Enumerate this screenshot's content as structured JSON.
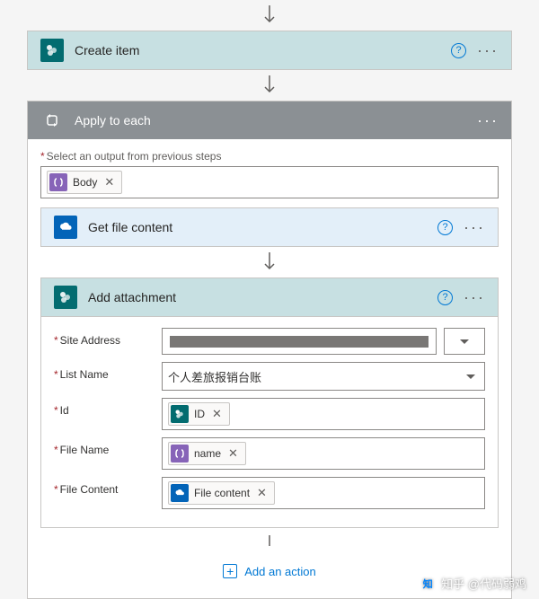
{
  "create_item": {
    "title": "Create item"
  },
  "apply": {
    "title": "Apply to each",
    "output_label": "Select an output from previous steps",
    "body_token": "Body"
  },
  "get_file": {
    "title": "Get file content"
  },
  "add_attachment": {
    "title": "Add attachment",
    "site_label": "Site Address",
    "list_label": "List Name",
    "list_value": "个人差旅报销台账",
    "id_label": "Id",
    "id_token": "ID",
    "filename_label": "File Name",
    "filename_token": "name",
    "filecontent_label": "File Content",
    "filecontent_token": "File content"
  },
  "add_action_label": "Add an action",
  "watermark": {
    "logo": "知",
    "text": "知乎 @代码弱鸡"
  }
}
